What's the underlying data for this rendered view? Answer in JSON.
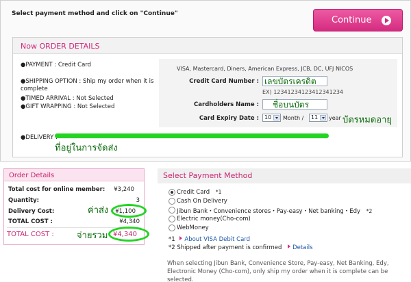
{
  "header": {
    "instruction": "Select payment method and click on \"Continue\"",
    "continue_label": "Continue"
  },
  "now_order": {
    "title": "Now ORDER DETAILS",
    "payment": "●PAYMENT : Credit Card",
    "shipping": "●SHIPPING OPTION : Ship my order when it is complete",
    "timed_arrival": "●TIMED ARRIVAL : Not Selected",
    "gift_wrapping": "●GIFT WRAPPING : Not Selected",
    "delivery": "●DELIVERY :"
  },
  "card_form": {
    "brands": "VISA, Mastercard, Diners, American Express, JCB, DC, UFJ NICOS",
    "number_label": "Credit Card Number :",
    "number_example": "EX) 12341234123412341234",
    "holder_label": "Cardholders Name :",
    "expiry_label": "Card Expiry Date :",
    "expiry_month": "10",
    "month_word": "Month /",
    "expiry_year": "11",
    "year_word": "year"
  },
  "annotations": {
    "card_number": "เลขบัตรเครดิต",
    "holder_name": "ชื่อบนบัตร",
    "expiry": "บัตรหมดอายุ",
    "delivery_address": "ที่อยู่ในการจัดส่ง",
    "shipping_cost": "ค่าส่ง",
    "total_paid": "จ่ายรวม"
  },
  "order_details": {
    "title": "Order Details",
    "rows": [
      {
        "label": "Total cost for online member:",
        "value": "¥3,240"
      },
      {
        "label": "Quantity:",
        "value": "3"
      },
      {
        "label": "Delivery Cost:",
        "value": "¥1,100"
      },
      {
        "label": "TOTAL COST :",
        "value": "¥4,340"
      }
    ],
    "grand_total_label": "TOTAL COST :",
    "grand_total_value": "¥4,340"
  },
  "payment_method": {
    "title": "Select Payment Method",
    "options": [
      {
        "label": "Credit Card",
        "suffix": "*1",
        "selected": true
      },
      {
        "label": "Cash On Delivery",
        "suffix": "",
        "selected": false
      },
      {
        "label": "Jibun Bank・Convenience stores・Pay-easy・Net banking・Edy",
        "suffix": "*2",
        "selected": false
      },
      {
        "label": "Electric money(Cho-com)",
        "suffix": "",
        "selected": false
      },
      {
        "label": "WebMoney",
        "suffix": "",
        "selected": false
      }
    ],
    "note1_prefix": "*1",
    "note1_link": "About VISA Debit Card",
    "note2": "*2 Shipped after payment is confirmed",
    "note2_link": "Details",
    "paragraph": "When selecting Jibun Bank, Convenience Store, Pay-easy, Net Banking, Edy, Electronic Money (Cho-com), only ship my order when it is complete can be selected."
  }
}
